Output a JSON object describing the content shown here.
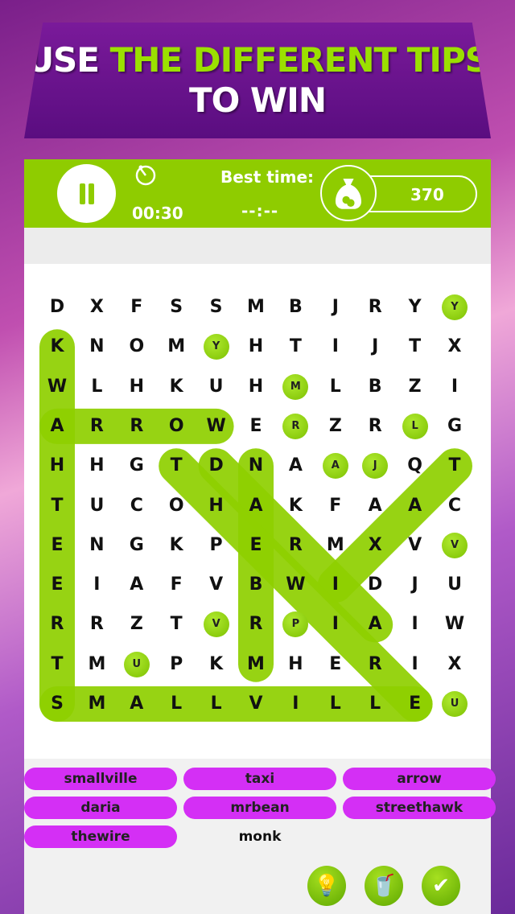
{
  "banner": {
    "line1_white": "USE",
    "line1_green": "THE DIFFERENT TIPS",
    "line2": "TO WIN"
  },
  "header": {
    "timer": "00:30",
    "best_label": "Best time:",
    "best_value": "--:--",
    "coins": "370",
    "icons": [
      "pause-icon",
      "stopwatch-icon",
      "money-bag-icon"
    ]
  },
  "grid": [
    "DXFSSMBJRYY",
    "KNOMYHTIJTX",
    "WLHKUHMLBZI",
    "ARROWERZRLG",
    "HHGTDNAAJQT",
    "TUCOHAKFAAC",
    "ENGKPERMXVV",
    "EIAFVBWIDJU",
    "RRZTVRPIAIW",
    "TMUPKMHERIX",
    "SMALLVILLEU"
  ],
  "hint_dots": [
    [
      0,
      10
    ],
    [
      1,
      4
    ],
    [
      2,
      6
    ],
    [
      3,
      6
    ],
    [
      3,
      9
    ],
    [
      4,
      7
    ],
    [
      4,
      8
    ],
    [
      6,
      10
    ],
    [
      8,
      4
    ],
    [
      8,
      6
    ],
    [
      9,
      2
    ],
    [
      10,
      10
    ]
  ],
  "found": [
    {
      "word": "streethawk",
      "from": [
        10,
        0
      ],
      "to": [
        1,
        0
      ]
    },
    {
      "word": "arrow",
      "from": [
        3,
        0
      ],
      "to": [
        3,
        4
      ]
    },
    {
      "word": "smallville",
      "from": [
        10,
        0
      ],
      "to": [
        10,
        9
      ]
    },
    {
      "word": "mrbean",
      "from": [
        9,
        5
      ],
      "to": [
        4,
        5
      ]
    },
    {
      "word": "taxi",
      "from": [
        4,
        10
      ],
      "to": [
        7,
        7
      ]
    },
    {
      "word": "daria",
      "from": [
        4,
        4
      ],
      "to": [
        8,
        8
      ]
    },
    {
      "word": "thewire",
      "from": [
        4,
        3
      ],
      "to": [
        10,
        9
      ]
    }
  ],
  "highlight_color": "#8fd000",
  "words": [
    {
      "label": "smallville",
      "found": true
    },
    {
      "label": "taxi",
      "found": true
    },
    {
      "label": "arrow",
      "found": true
    },
    {
      "label": "daria",
      "found": true
    },
    {
      "label": "mrbean",
      "found": true
    },
    {
      "label": "streethawk",
      "found": true
    },
    {
      "label": "thewire",
      "found": true
    },
    {
      "label": "monk",
      "found": false
    }
  ],
  "buttons": [
    {
      "name": "hint-bulb-button",
      "icon": "lightbulb-icon"
    },
    {
      "name": "drink-button",
      "icon": "drink-cup-icon"
    },
    {
      "name": "check-button",
      "icon": "checkmark-icon"
    }
  ]
}
